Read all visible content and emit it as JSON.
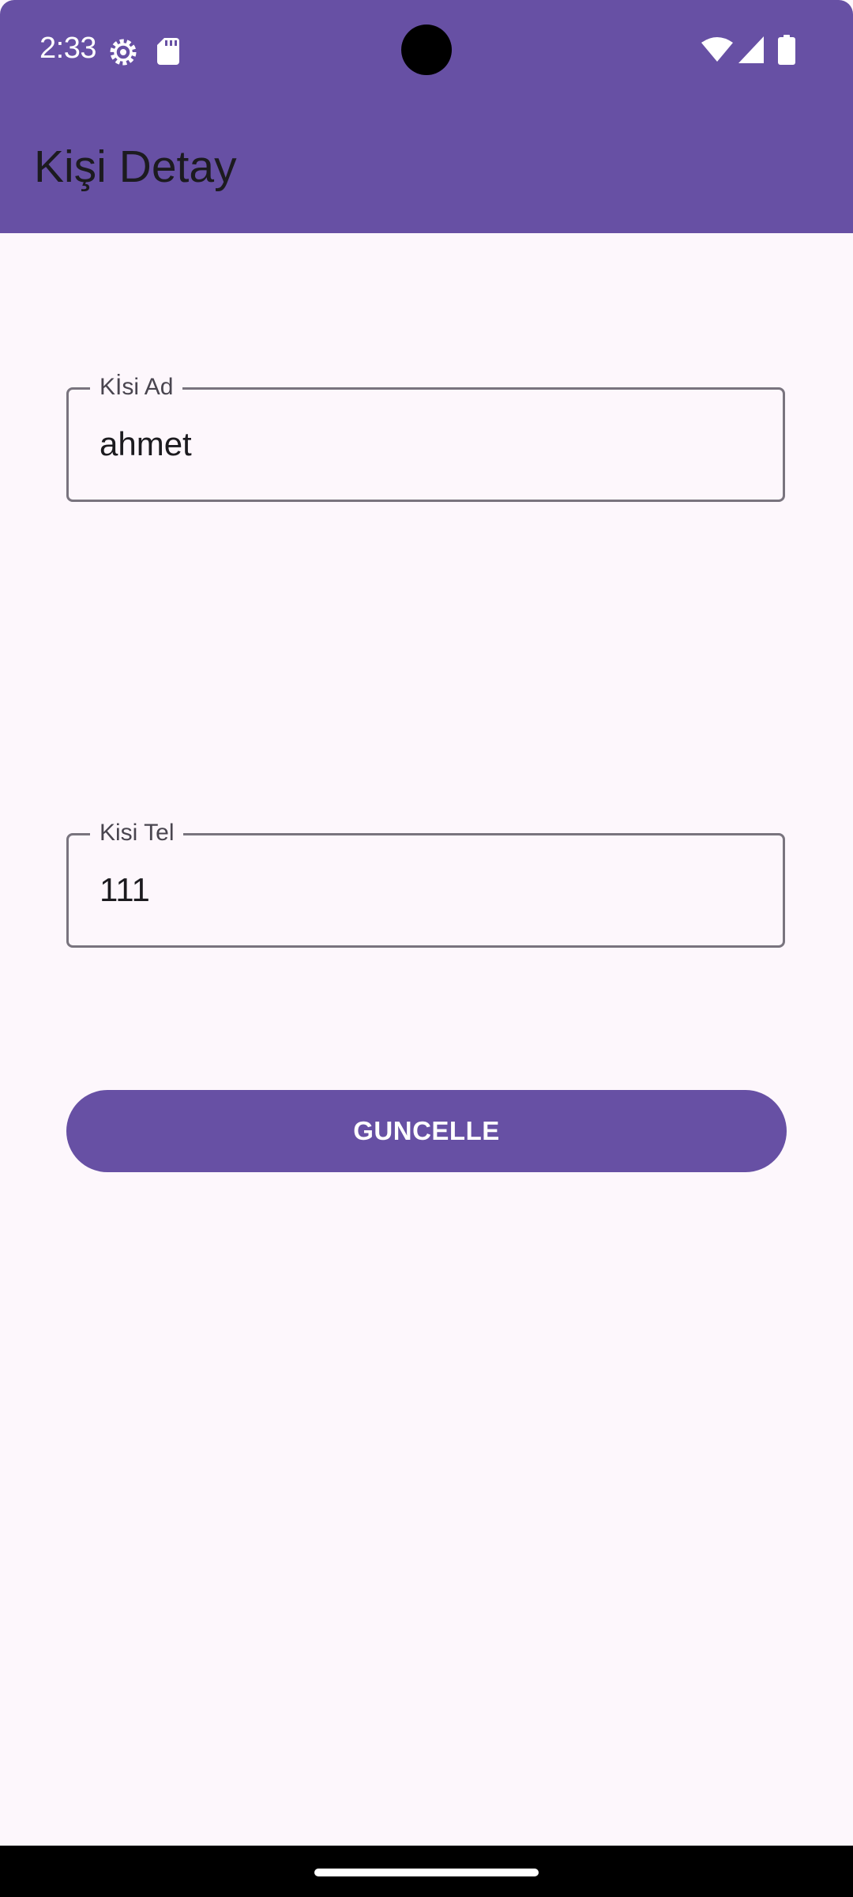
{
  "status_bar": {
    "time": "2:33",
    "icons": [
      "settings-gear-icon",
      "sd-card-icon",
      "wifi-icon",
      "cellular-signal-icon",
      "battery-icon"
    ]
  },
  "app_bar": {
    "title": "Kişi Detay"
  },
  "form": {
    "name_field": {
      "label": "Kİsi Ad",
      "value": "ahmet"
    },
    "phone_field": {
      "label": "Kisi Tel",
      "value": "111"
    },
    "update_button": {
      "label": "GUNCELLE"
    }
  },
  "colors": {
    "primary": "#6750a4",
    "background": "#fdf7fc",
    "on_surface": "#1c1b1f",
    "outline": "#79747e",
    "label": "#49454f"
  }
}
